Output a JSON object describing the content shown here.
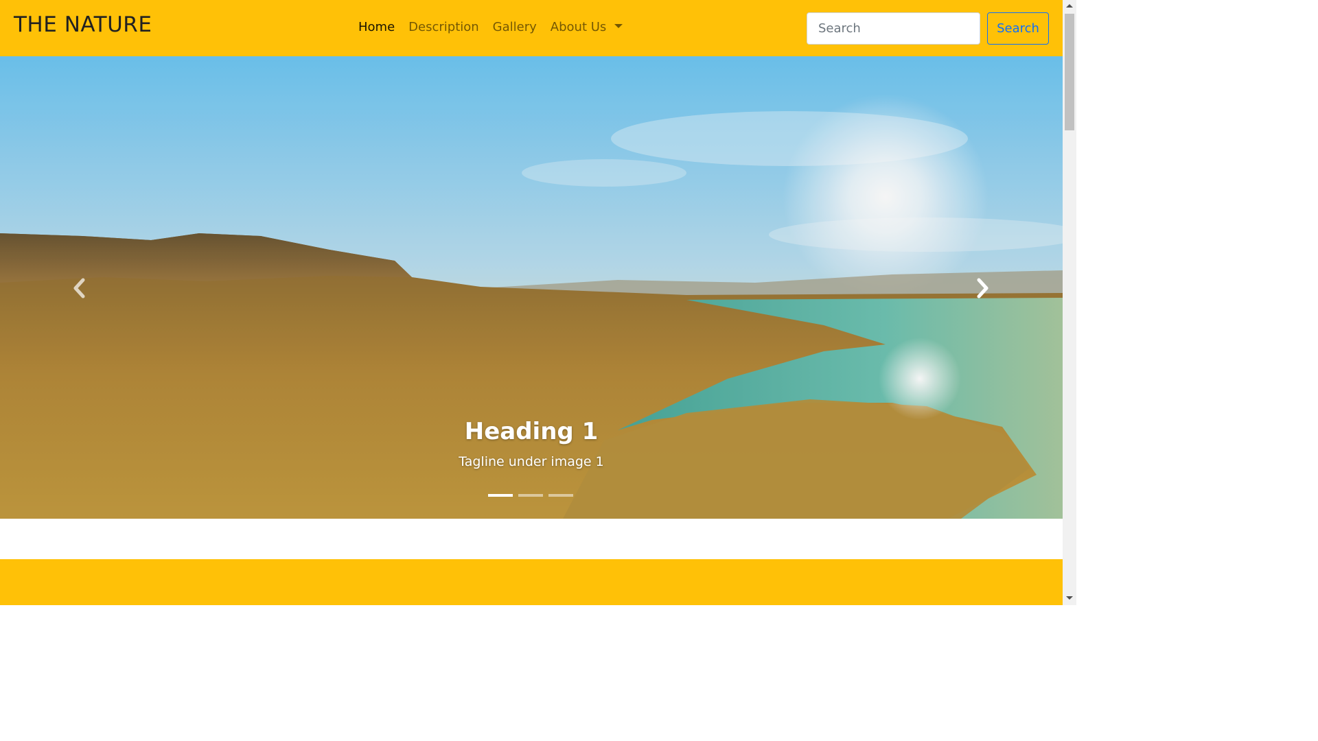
{
  "navbar": {
    "brand": "THE NATURE",
    "links": [
      {
        "label": "Home",
        "active": true
      },
      {
        "label": "Description",
        "active": false
      },
      {
        "label": "Gallery",
        "active": false
      },
      {
        "label": "About Us",
        "active": false,
        "dropdown": true
      }
    ],
    "search": {
      "placeholder": "Search",
      "value": "",
      "button_label": "Search"
    }
  },
  "carousel": {
    "slide": {
      "heading": "Heading 1",
      "tagline": "Tagline under image 1"
    },
    "indicators": [
      {
        "active": true
      },
      {
        "active": false
      },
      {
        "active": false
      }
    ],
    "prev_icon": "chevron-left-icon",
    "next_icon": "chevron-right-icon"
  },
  "colors": {
    "navbar_bg": "#ffc107",
    "footer_bg": "#ffc107",
    "search_button": "#0d6efd"
  }
}
